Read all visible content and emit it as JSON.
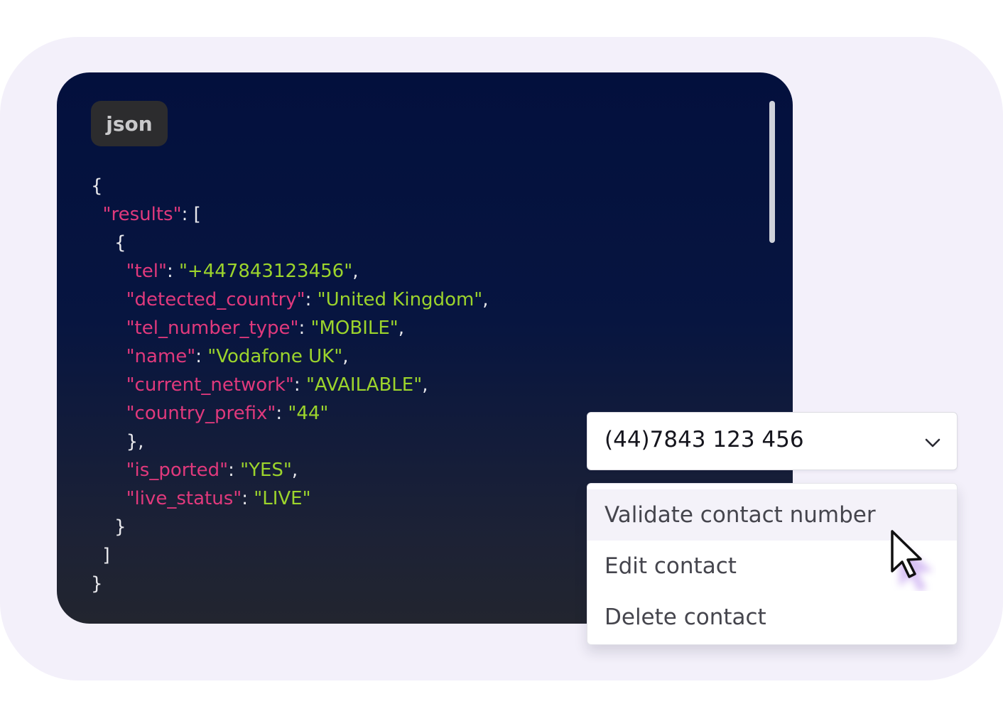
{
  "code_panel": {
    "language": "json",
    "lines": [
      [
        {
          "t": "p",
          "v": "{"
        }
      ],
      [
        {
          "t": "p",
          "v": "  "
        },
        {
          "t": "k",
          "v": "\"results\""
        },
        {
          "t": "p",
          "v": ": ["
        }
      ],
      [
        {
          "t": "p",
          "v": "    {"
        }
      ],
      [
        {
          "t": "p",
          "v": "      "
        },
        {
          "t": "k",
          "v": "\"tel\""
        },
        {
          "t": "p",
          "v": ": "
        },
        {
          "t": "s",
          "v": "\"+447843123456\""
        },
        {
          "t": "p",
          "v": ","
        }
      ],
      [
        {
          "t": "p",
          "v": "      "
        },
        {
          "t": "k",
          "v": "\"detected_country\""
        },
        {
          "t": "p",
          "v": ": "
        },
        {
          "t": "s",
          "v": "\"United Kingdom\""
        },
        {
          "t": "p",
          "v": ","
        }
      ],
      [
        {
          "t": "p",
          "v": "      "
        },
        {
          "t": "k",
          "v": "\"tel_number_type\""
        },
        {
          "t": "p",
          "v": ": "
        },
        {
          "t": "s",
          "v": "\"MOBILE\""
        },
        {
          "t": "p",
          "v": ","
        }
      ],
      [
        {
          "t": "p",
          "v": "      "
        },
        {
          "t": "k",
          "v": "\"name\""
        },
        {
          "t": "p",
          "v": ": "
        },
        {
          "t": "s",
          "v": "\"Vodafone UK\""
        },
        {
          "t": "p",
          "v": ","
        }
      ],
      [
        {
          "t": "p",
          "v": "      "
        },
        {
          "t": "k",
          "v": "\"current_network\""
        },
        {
          "t": "p",
          "v": ": "
        },
        {
          "t": "s",
          "v": "\"AVAILABLE\""
        },
        {
          "t": "p",
          "v": ","
        }
      ],
      [
        {
          "t": "p",
          "v": "      "
        },
        {
          "t": "k",
          "v": "\"country_prefix\""
        },
        {
          "t": "p",
          "v": ": "
        },
        {
          "t": "s",
          "v": "\"44\""
        }
      ],
      [
        {
          "t": "p",
          "v": "      },"
        }
      ],
      [
        {
          "t": "p",
          "v": "      "
        },
        {
          "t": "k",
          "v": "\"is_ported\""
        },
        {
          "t": "p",
          "v": ": "
        },
        {
          "t": "s",
          "v": "\"YES\""
        },
        {
          "t": "p",
          "v": ","
        }
      ],
      [
        {
          "t": "p",
          "v": "      "
        },
        {
          "t": "k",
          "v": "\"live_status\""
        },
        {
          "t": "p",
          "v": ": "
        },
        {
          "t": "s",
          "v": "\"LIVE\""
        }
      ],
      [
        {
          "t": "p",
          "v": "    }"
        }
      ],
      [
        {
          "t": "p",
          "v": "  ]"
        }
      ],
      [
        {
          "t": "p",
          "v": "}"
        }
      ]
    ]
  },
  "phone_select": {
    "value": "(44)7843 123 456"
  },
  "menu": {
    "items": [
      {
        "label": "Validate contact number",
        "hovered": true
      },
      {
        "label": "Edit contact",
        "hovered": false
      },
      {
        "label": "Delete contact",
        "hovered": false
      }
    ]
  },
  "colors": {
    "key": "#e0397c",
    "string": "#9cd42c",
    "punctuation": "#e8e8ec",
    "backdrop": "#f3f0fa"
  },
  "icons": {
    "select_toggle": "chevron-down-icon",
    "pointer": "cursor-arrow-icon"
  }
}
